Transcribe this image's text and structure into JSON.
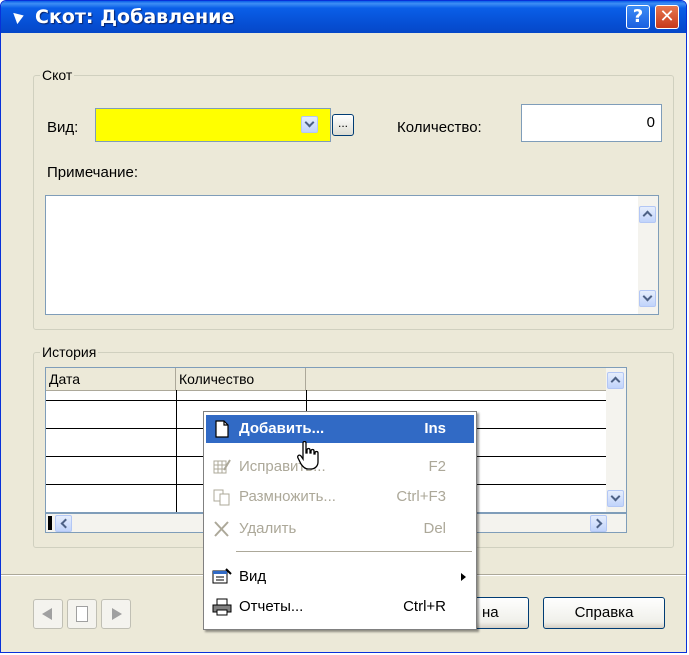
{
  "window": {
    "title": "Скот: Добавление",
    "help_glyph": "?",
    "close_glyph": "✕"
  },
  "group_cattle": {
    "title": "Скот",
    "kind_label": "Вид:",
    "kind_value": "",
    "kind_field_color": "#ffff00",
    "browse_label": "...",
    "quantity_label": "Количество:",
    "quantity_value": "0",
    "note_label": "Примечание:",
    "note_value": ""
  },
  "group_history": {
    "title": "История",
    "columns": [
      "Дата",
      "Количество"
    ]
  },
  "context_menu": {
    "items": [
      {
        "label": "Добавить...",
        "shortcut": "Ins",
        "icon": "new-document-icon",
        "state": "highlighted"
      },
      {
        "label": "Исправить...",
        "shortcut": "F2",
        "icon": "edit-table-icon",
        "state": "disabled"
      },
      {
        "label": "Размножить...",
        "shortcut": "Ctrl+F3",
        "icon": "copy-icon",
        "state": "disabled"
      },
      {
        "label": "Удалить",
        "shortcut": "Del",
        "icon": "delete-x-icon",
        "state": "disabled"
      },
      {
        "label": "Вид",
        "shortcut": "",
        "icon": "view-icon",
        "state": "submenu"
      },
      {
        "label": "Отчеты...",
        "shortcut": "Ctrl+R",
        "icon": "printer-icon",
        "state": "normal"
      }
    ]
  },
  "footer": {
    "partial_button_label": "на",
    "help_button_label": "Справка"
  },
  "colors": {
    "titlebar": "#0a5fe8",
    "highlight": "#316ac5",
    "dialog_bg": "#ece9d8"
  }
}
